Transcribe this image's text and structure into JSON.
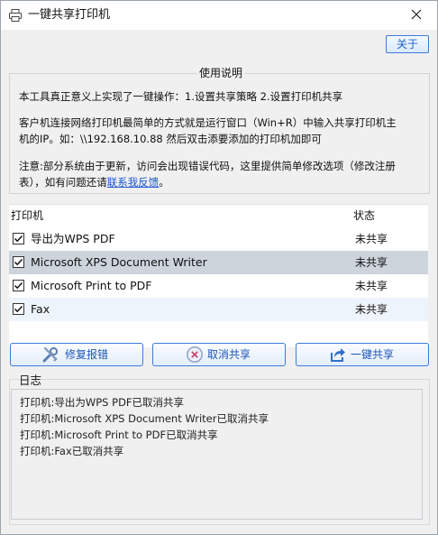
{
  "window": {
    "title": "一键共享打印机"
  },
  "header": {
    "about_label": "关于"
  },
  "usage": {
    "legend": "使用说明",
    "para1": "本工具真正意义上实现了一键操作：1.设置共享策略 2.设置打印机共享",
    "para2_line1": "客户机连接网络打印机最简单的方式就是运行窗口（Win+R）中输入共享打印机主",
    "para2_line2": "机的IP。如：\\\\192.168.10.88 然后双击添要添加的打印机加即可",
    "para3_line1": "注意:部分系统由于更新，访问会出现错误代码，这里提供简单修改选项（修改注册",
    "para3_line2_prefix": "表），如有问题还请",
    "feedback_link": "联系我反馈",
    "para3_line2_suffix": "。"
  },
  "printer_list": {
    "columns": {
      "printer": "打印机",
      "status": "状态"
    },
    "rows": [
      {
        "name": "导出为WPS PDF",
        "status": "未共享",
        "checked": true
      },
      {
        "name": "Microsoft XPS Document Writer",
        "status": "未共享",
        "checked": true
      },
      {
        "name": "Microsoft Print to PDF",
        "status": "未共享",
        "checked": true
      },
      {
        "name": "Fax",
        "status": "未共享",
        "checked": true
      }
    ]
  },
  "actions": {
    "repair_label": "修复报错",
    "cancel_share_label": "取消共享",
    "share_label": "一键共享",
    "icons": {
      "repair": "tools-icon",
      "cancel": "cancel-circle-icon",
      "share": "share-arrow-icon"
    }
  },
  "log": {
    "legend": "日志",
    "lines": [
      "打印机:导出为WPS PDF已取消共享",
      "打印机:Microsoft XPS Document Writer已取消共享",
      "打印机:Microsoft Print to PDF已取消共享",
      "打印机:Fax已取消共享"
    ]
  },
  "colors": {
    "accent": "#3d7bd9",
    "selected_row": "#cdd4dc",
    "alt_row": "#eef4fb",
    "link": "#1a56d6"
  }
}
